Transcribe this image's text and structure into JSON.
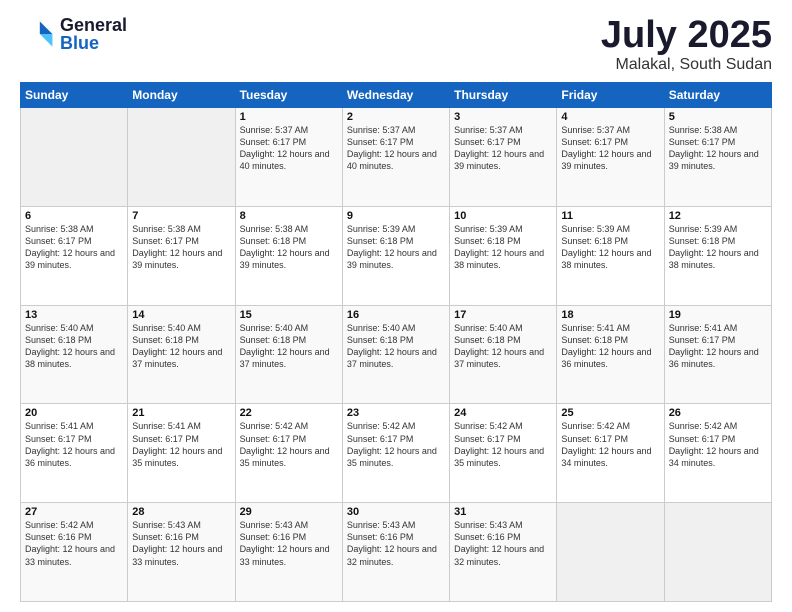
{
  "logo": {
    "general": "General",
    "blue": "Blue"
  },
  "title": {
    "month_year": "July 2025",
    "location": "Malakal, South Sudan"
  },
  "days_of_week": [
    "Sunday",
    "Monday",
    "Tuesday",
    "Wednesday",
    "Thursday",
    "Friday",
    "Saturday"
  ],
  "weeks": [
    [
      {
        "day": "",
        "info": ""
      },
      {
        "day": "",
        "info": ""
      },
      {
        "day": "1",
        "info": "Sunrise: 5:37 AM\nSunset: 6:17 PM\nDaylight: 12 hours and 40 minutes."
      },
      {
        "day": "2",
        "info": "Sunrise: 5:37 AM\nSunset: 6:17 PM\nDaylight: 12 hours and 40 minutes."
      },
      {
        "day": "3",
        "info": "Sunrise: 5:37 AM\nSunset: 6:17 PM\nDaylight: 12 hours and 39 minutes."
      },
      {
        "day": "4",
        "info": "Sunrise: 5:37 AM\nSunset: 6:17 PM\nDaylight: 12 hours and 39 minutes."
      },
      {
        "day": "5",
        "info": "Sunrise: 5:38 AM\nSunset: 6:17 PM\nDaylight: 12 hours and 39 minutes."
      }
    ],
    [
      {
        "day": "6",
        "info": "Sunrise: 5:38 AM\nSunset: 6:17 PM\nDaylight: 12 hours and 39 minutes."
      },
      {
        "day": "7",
        "info": "Sunrise: 5:38 AM\nSunset: 6:17 PM\nDaylight: 12 hours and 39 minutes."
      },
      {
        "day": "8",
        "info": "Sunrise: 5:38 AM\nSunset: 6:18 PM\nDaylight: 12 hours and 39 minutes."
      },
      {
        "day": "9",
        "info": "Sunrise: 5:39 AM\nSunset: 6:18 PM\nDaylight: 12 hours and 39 minutes."
      },
      {
        "day": "10",
        "info": "Sunrise: 5:39 AM\nSunset: 6:18 PM\nDaylight: 12 hours and 38 minutes."
      },
      {
        "day": "11",
        "info": "Sunrise: 5:39 AM\nSunset: 6:18 PM\nDaylight: 12 hours and 38 minutes."
      },
      {
        "day": "12",
        "info": "Sunrise: 5:39 AM\nSunset: 6:18 PM\nDaylight: 12 hours and 38 minutes."
      }
    ],
    [
      {
        "day": "13",
        "info": "Sunrise: 5:40 AM\nSunset: 6:18 PM\nDaylight: 12 hours and 38 minutes."
      },
      {
        "day": "14",
        "info": "Sunrise: 5:40 AM\nSunset: 6:18 PM\nDaylight: 12 hours and 37 minutes."
      },
      {
        "day": "15",
        "info": "Sunrise: 5:40 AM\nSunset: 6:18 PM\nDaylight: 12 hours and 37 minutes."
      },
      {
        "day": "16",
        "info": "Sunrise: 5:40 AM\nSunset: 6:18 PM\nDaylight: 12 hours and 37 minutes."
      },
      {
        "day": "17",
        "info": "Sunrise: 5:40 AM\nSunset: 6:18 PM\nDaylight: 12 hours and 37 minutes."
      },
      {
        "day": "18",
        "info": "Sunrise: 5:41 AM\nSunset: 6:18 PM\nDaylight: 12 hours and 36 minutes."
      },
      {
        "day": "19",
        "info": "Sunrise: 5:41 AM\nSunset: 6:17 PM\nDaylight: 12 hours and 36 minutes."
      }
    ],
    [
      {
        "day": "20",
        "info": "Sunrise: 5:41 AM\nSunset: 6:17 PM\nDaylight: 12 hours and 36 minutes."
      },
      {
        "day": "21",
        "info": "Sunrise: 5:41 AM\nSunset: 6:17 PM\nDaylight: 12 hours and 35 minutes."
      },
      {
        "day": "22",
        "info": "Sunrise: 5:42 AM\nSunset: 6:17 PM\nDaylight: 12 hours and 35 minutes."
      },
      {
        "day": "23",
        "info": "Sunrise: 5:42 AM\nSunset: 6:17 PM\nDaylight: 12 hours and 35 minutes."
      },
      {
        "day": "24",
        "info": "Sunrise: 5:42 AM\nSunset: 6:17 PM\nDaylight: 12 hours and 35 minutes."
      },
      {
        "day": "25",
        "info": "Sunrise: 5:42 AM\nSunset: 6:17 PM\nDaylight: 12 hours and 34 minutes."
      },
      {
        "day": "26",
        "info": "Sunrise: 5:42 AM\nSunset: 6:17 PM\nDaylight: 12 hours and 34 minutes."
      }
    ],
    [
      {
        "day": "27",
        "info": "Sunrise: 5:42 AM\nSunset: 6:16 PM\nDaylight: 12 hours and 33 minutes."
      },
      {
        "day": "28",
        "info": "Sunrise: 5:43 AM\nSunset: 6:16 PM\nDaylight: 12 hours and 33 minutes."
      },
      {
        "day": "29",
        "info": "Sunrise: 5:43 AM\nSunset: 6:16 PM\nDaylight: 12 hours and 33 minutes."
      },
      {
        "day": "30",
        "info": "Sunrise: 5:43 AM\nSunset: 6:16 PM\nDaylight: 12 hours and 32 minutes."
      },
      {
        "day": "31",
        "info": "Sunrise: 5:43 AM\nSunset: 6:16 PM\nDaylight: 12 hours and 32 minutes."
      },
      {
        "day": "",
        "info": ""
      },
      {
        "day": "",
        "info": ""
      }
    ]
  ]
}
